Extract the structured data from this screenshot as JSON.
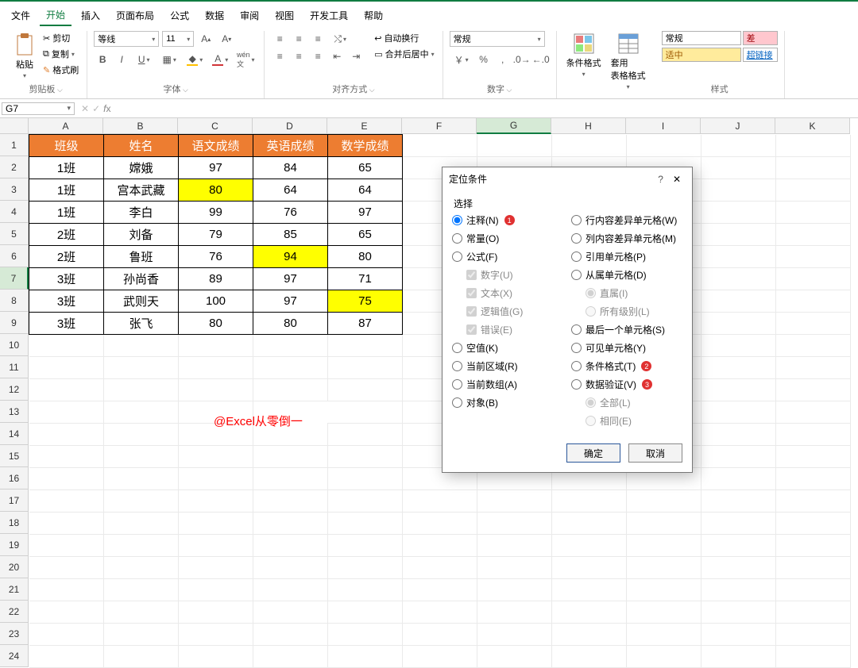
{
  "menu": {
    "file": "文件",
    "home": "开始",
    "insert": "插入",
    "layout": "页面布局",
    "formula": "公式",
    "data": "数据",
    "review": "审阅",
    "view": "视图",
    "dev": "开发工具",
    "help": "帮助"
  },
  "ribbon": {
    "clipboard": {
      "paste": "粘贴",
      "cut": "剪切",
      "copy": "复制",
      "fmtpainter": "格式刷",
      "label": "剪贴板"
    },
    "font": {
      "name": "等线",
      "size": "11",
      "label": "字体"
    },
    "align": {
      "wrap": "自动换行",
      "merge": "合并后居中",
      "label": "对齐方式"
    },
    "number": {
      "fmt": "常规",
      "label": "数字"
    },
    "styles_btns": {
      "condfmt": "条件格式",
      "tblfmt": "套用\n表格格式",
      "label": "样式"
    },
    "styles": {
      "changgui": "常规",
      "cha": "差",
      "shizhong": "适中",
      "chaolianjie": "超链接"
    }
  },
  "namebox": "G7",
  "columns": [
    "A",
    "B",
    "C",
    "D",
    "E",
    "F",
    "G",
    "H",
    "I",
    "J",
    "K"
  ],
  "rows_count": 24,
  "selected": {
    "col": "G",
    "row": 7
  },
  "table": {
    "headers": [
      "班级",
      "姓名",
      "语文成绩",
      "英语成绩",
      "数学成绩"
    ],
    "rows": [
      [
        "1班",
        "嫦娥",
        "97",
        "84",
        "65"
      ],
      [
        "1班",
        "宫本武藏",
        "80",
        "64",
        "64"
      ],
      [
        "1班",
        "李白",
        "99",
        "76",
        "97"
      ],
      [
        "2班",
        "刘备",
        "79",
        "85",
        "65"
      ],
      [
        "2班",
        "鲁班",
        "76",
        "94",
        "80"
      ],
      [
        "3班",
        "孙尚香",
        "89",
        "97",
        "71"
      ],
      [
        "3班",
        "武则天",
        "100",
        "97",
        "75"
      ],
      [
        "3班",
        "张飞",
        "80",
        "80",
        "87"
      ]
    ],
    "highlights": [
      [
        1,
        2
      ],
      [
        4,
        3
      ],
      [
        6,
        4
      ]
    ]
  },
  "watermark": "@Excel从零倒一",
  "dialog": {
    "title": "定位条件",
    "section": "选择",
    "left": {
      "note": "注释(N)",
      "const": "常量(O)",
      "formula": "公式(F)",
      "number": "数字(U)",
      "text": "文本(X)",
      "logic": "逻辑值(G)",
      "error": "错误(E)",
      "blank": "空值(K)",
      "curregion": "当前区域(R)",
      "curarray": "当前数组(A)",
      "object": "对象(B)"
    },
    "right": {
      "rowdiff": "行内容差异单元格(W)",
      "coldiff": "列内容差异单元格(M)",
      "precedent": "引用单元格(P)",
      "dependent": "从属单元格(D)",
      "direct": "直属(I)",
      "alllevels": "所有级别(L)",
      "lastcell": "最后一个单元格(S)",
      "visible": "可见单元格(Y)",
      "condfmt": "条件格式(T)",
      "datavalid": "数据验证(V)",
      "all": "全部(L)",
      "same": "相同(E)"
    },
    "ok": "确定",
    "cancel": "取消"
  }
}
